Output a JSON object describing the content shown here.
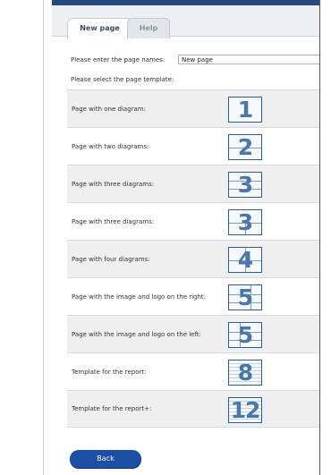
{
  "tabs": [
    {
      "label": "New page",
      "active": true
    },
    {
      "label": "Help",
      "active": false
    }
  ],
  "form": {
    "name_label": "Please enter the page names:",
    "name_value": "New page",
    "template_label": "Please select the page template:"
  },
  "templates": [
    {
      "label": "Page with one diagram:",
      "icon_number": "1"
    },
    {
      "label": "Page with two diagrams:",
      "icon_number": "2"
    },
    {
      "label": "Page with three diagrams:",
      "icon_number": "3"
    },
    {
      "label": "Page with three diagrams:",
      "icon_number": "3"
    },
    {
      "label": "Page with four diagrams:",
      "icon_number": "4"
    },
    {
      "label": "Page with the image and logo on the right:",
      "icon_number": "5"
    },
    {
      "label": "Page with the image and logo on the left:",
      "icon_number": "5"
    },
    {
      "label": "Template for the report:",
      "icon_number": "8"
    },
    {
      "label": "Template for the report+:",
      "icon_number": "12"
    }
  ],
  "back_label": "Back",
  "colors": {
    "accent": "#254a7c",
    "button": "#1d4ea5",
    "icon_border": "#2e5d91",
    "row_shade": "#efefef"
  }
}
